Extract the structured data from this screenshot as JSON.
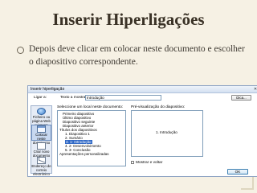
{
  "slide": {
    "title": "Inserir Hiperligações",
    "bullet": "Depois deve clicar em colocar neste documento e escolher o diapositivo correspondente."
  },
  "dialog": {
    "title": "Inserir hiperligação",
    "close_glyph": "✕",
    "link_to_label": "Ligar a:",
    "text_to_show_label": "Texto a mostrar:",
    "text_to_show_value": "Introdução",
    "tip_button": "Dica...",
    "place_label": "Seleccione um local neste documento:",
    "preview_label": "Pré-visualização do diapositivo:",
    "preview_text": "1. Introdução",
    "show_return_label": "Mostrar e voltar",
    "ok_button": "OK",
    "link_bar": [
      {
        "label": "Ficheiro ou página Web existente",
        "icon": "globe-icon"
      },
      {
        "label": "Colocar neste documento",
        "icon": "document-icon",
        "selected": true
      },
      {
        "label": "Criar novo documento",
        "icon": "new-document-icon"
      },
      {
        "label": "Endereço de correio electrónico",
        "icon": "mail-icon"
      }
    ],
    "tree": [
      "Primeiro diapositivo",
      "Último diapositivo",
      "Diapositivo seguinte",
      "Diapositivo anterior",
      "Títulos dos diapositivos",
      "1. Diapositivo 1",
      "2. Sumário",
      "3. 1- Introdução",
      "4. 2- Desenvolvimento",
      "5. 3- Conclusão",
      "Apresentações personalizadas"
    ]
  }
}
